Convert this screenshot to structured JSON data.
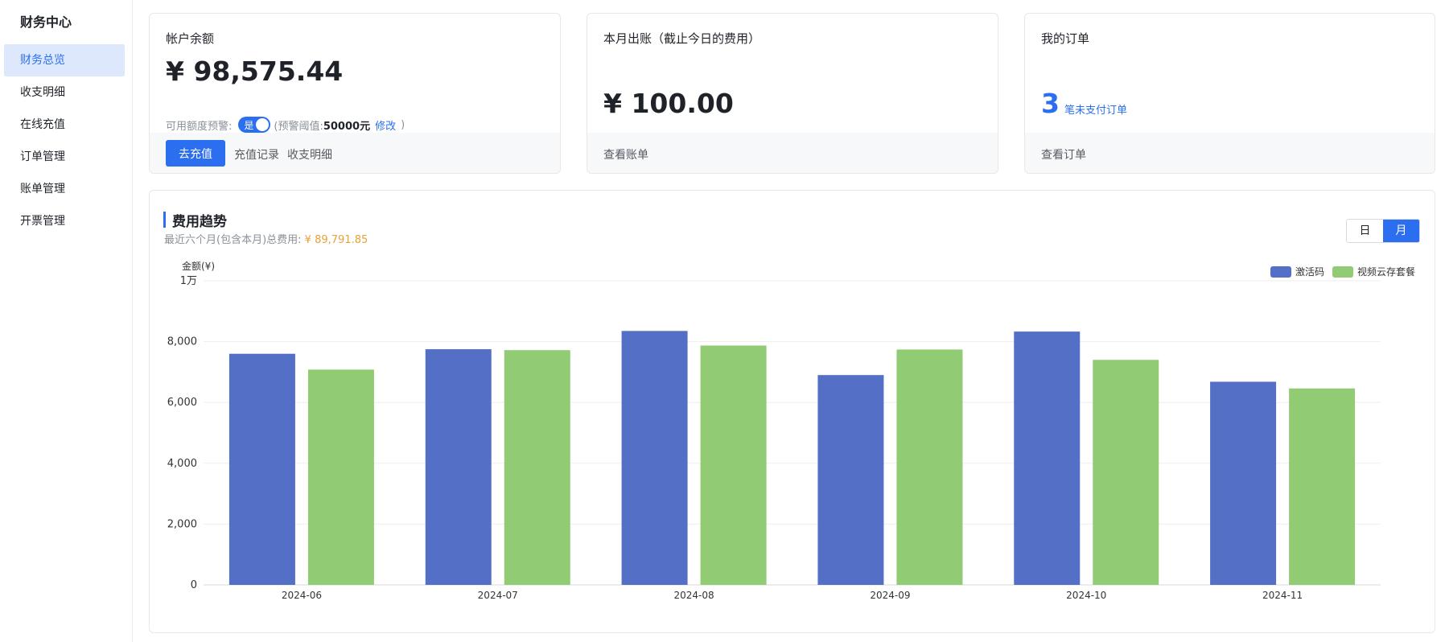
{
  "sidebar": {
    "title": "财务中心",
    "items": [
      {
        "label": "财务总览",
        "active": true
      },
      {
        "label": "收支明细",
        "active": false
      },
      {
        "label": "在线充值",
        "active": false
      },
      {
        "label": "订单管理",
        "active": false
      },
      {
        "label": "账单管理",
        "active": false
      },
      {
        "label": "开票管理",
        "active": false
      }
    ]
  },
  "balance_card": {
    "title": "帐户余额",
    "amount": "¥ 98,575.44",
    "warn_label": "可用额度预警:",
    "toggle_text": "是",
    "warn_prefix": "(预警阈值:",
    "warn_value": "50000元",
    "warn_edit": "修改",
    "warn_suffix": ")",
    "recharge_button": "去充值",
    "recharge_record": "充值记录",
    "income_detail": "收支明细"
  },
  "bill_card": {
    "title": "本月出账（截止今日的费用）",
    "amount": "¥ 100.00",
    "view_bill": "查看账单"
  },
  "orders_card": {
    "title": "我的订单",
    "count": "3",
    "count_label": "笔未支付订单",
    "view_orders": "查看订单"
  },
  "trend": {
    "title": "费用趋势",
    "subtitle_prefix": "最近六个月(包含本月)总费用:",
    "subtitle_value": "¥ 89,791.85",
    "granularity": [
      {
        "label": "日",
        "active": false
      },
      {
        "label": "月",
        "active": true
      }
    ]
  },
  "colors": {
    "accent": "#2b6ef0",
    "series_1": "#5470c6",
    "series_2": "#91cc75",
    "highlight": "#e8a23a"
  },
  "chart_data": {
    "type": "bar",
    "ylabel": "金额(¥)",
    "ylim": [
      0,
      10000
    ],
    "yticks": [
      "0",
      "2,000",
      "4,000",
      "6,000",
      "8,000",
      "1万"
    ],
    "categories": [
      "2024-06",
      "2024-07",
      "2024-08",
      "2024-09",
      "2024-10",
      "2024-11"
    ],
    "series": [
      {
        "name": "激活码",
        "values": [
          7600,
          7750,
          8350,
          6900,
          8330,
          6680
        ]
      },
      {
        "name": "视频云存套餐",
        "values": [
          7080,
          7720,
          7870,
          7740,
          7400,
          6460
        ]
      }
    ],
    "legend_position": "top-right",
    "grid": true
  }
}
